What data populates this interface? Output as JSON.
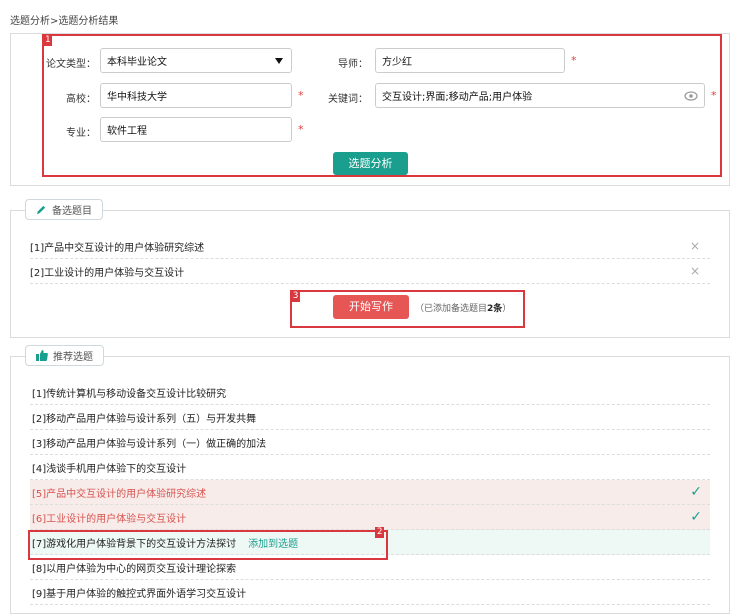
{
  "breadcrumb": "选题分析>选题分析结果",
  "form": {
    "thesis_type_label": "论文类型：",
    "thesis_type_value": "本科毕业论文",
    "advisor_label": "导师：",
    "advisor_value": "方少红",
    "school_label": "高校：",
    "school_value": "华中科技大学",
    "keywords_label": "关键词：",
    "keywords_value": "交互设计;界面;移动产品;用户体验",
    "major_label": "专业：",
    "major_value": "软件工程",
    "required_mark": "*",
    "analyze_button": "选题分析"
  },
  "candidates": {
    "tab_label": "备选题目",
    "items": [
      "[1]产品中交互设计的用户体验研究综述",
      "[2]工业设计的用户体验与交互设计"
    ],
    "start_button": "开始写作",
    "note_prefix": "（已添加备选题目",
    "note_count": "2条",
    "note_suffix": "）",
    "remove_symbol": "×"
  },
  "recommend": {
    "tab_label": "推荐选题",
    "add_link": "添加到选题",
    "check_symbol": "✓",
    "items": [
      "[1]传统计算机与移动设备交互设计比较研究",
      "[2]移动产品用户体验与设计系列（五）与开发共舞",
      "[3]移动产品用户体验与设计系列（一）做正确的加法",
      "[4]浅谈手机用户体验下的交互设计",
      "[5]产品中交互设计的用户体验研究综述",
      "[6]工业设计的用户体验与交互设计",
      "[7]游戏化用户体验背景下的交互设计方法探讨",
      "[8]以用户体验为中心的网页交互设计理论探索",
      "[9]基于用户体验的触控式界面外语学习交互设计"
    ]
  },
  "annotations": [
    "1",
    "2",
    "3"
  ],
  "colors": {
    "teal": "#1a9f8e",
    "red": "#d9393e"
  }
}
